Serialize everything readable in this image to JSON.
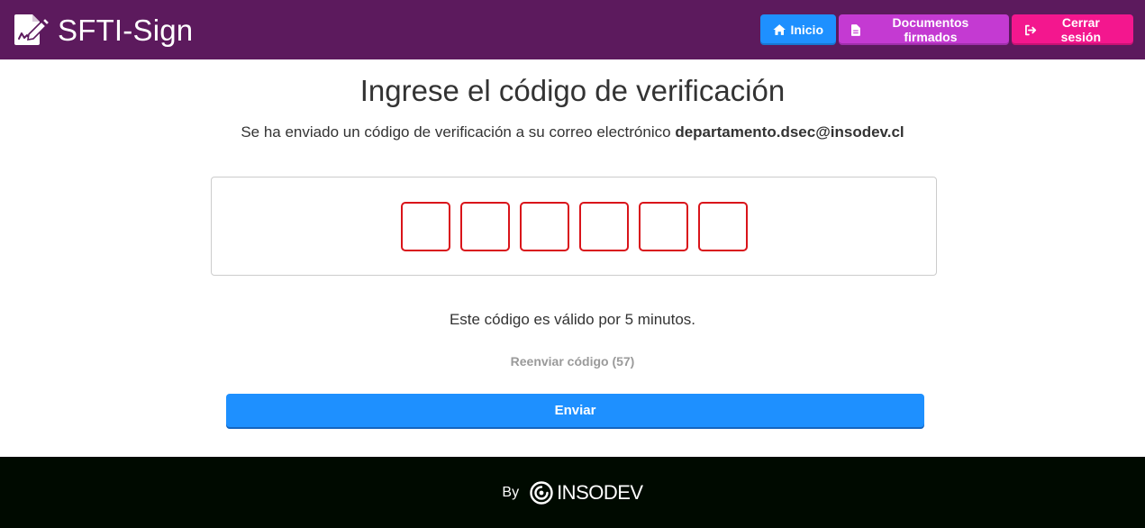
{
  "header": {
    "brand_name": "SFTI-Sign",
    "brand_icon": "document-signature-icon",
    "background_color": "#5c1a5d",
    "nav": [
      {
        "label": "Inicio",
        "icon": "home-icon",
        "color": "#1e90ff"
      },
      {
        "label": "Documentos firmados",
        "icon": "file-icon",
        "color": "#c43ad2"
      },
      {
        "label": "Cerrar sesión",
        "icon": "logout-icon",
        "color": "#f3178e"
      }
    ]
  },
  "main": {
    "title": "Ingrese el código de verificación",
    "subtitle_prefix": "Se ha enviado un código de verificación a su correo electrónico",
    "email": "departamento.dsec@insodev.cl",
    "code_inputs": [
      {
        "value": ""
      },
      {
        "value": ""
      },
      {
        "value": ""
      },
      {
        "value": ""
      },
      {
        "value": ""
      },
      {
        "value": ""
      }
    ],
    "code_box_border_color": "#d9141a",
    "validity_text": "Este código es válido por 5 minutos.",
    "resend_label": "Reenviar código (57)",
    "submit_label": "Enviar"
  },
  "footer": {
    "by_label": "By",
    "brand_name": "INSODEV",
    "brand_icon": "insodev-logo-icon",
    "background_color": "#000a00"
  }
}
